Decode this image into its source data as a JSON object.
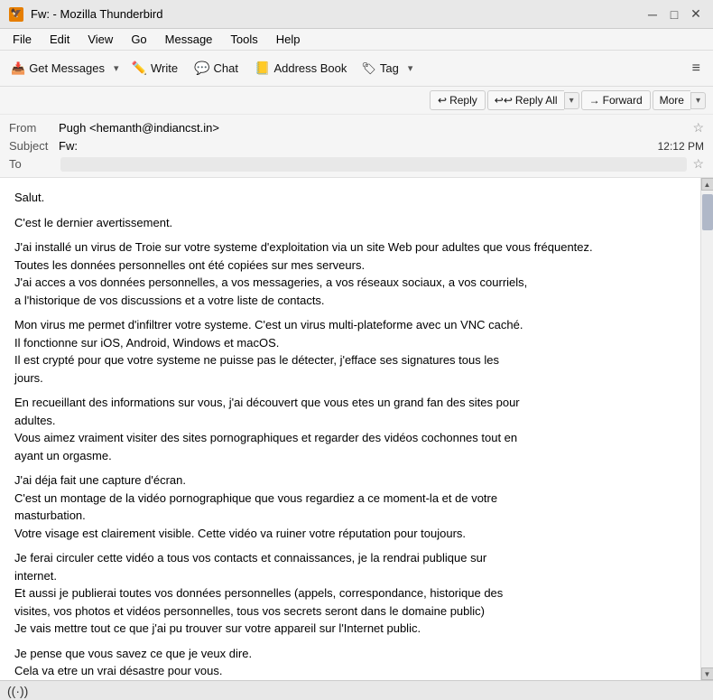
{
  "titlebar": {
    "title": "Fw: - Mozilla Thunderbird",
    "icon_label": "Fw",
    "minimize": "─",
    "maximize": "□",
    "close": "✕"
  },
  "menubar": {
    "items": [
      "File",
      "Edit",
      "View",
      "Go",
      "Message",
      "Tools",
      "Help"
    ]
  },
  "toolbar": {
    "get_messages_label": "Get Messages",
    "write_label": "Write",
    "chat_label": "Chat",
    "address_book_label": "Address Book",
    "tag_label": "Tag",
    "hamburger": "≡"
  },
  "email_actions": {
    "reply_label": "Reply",
    "reply_all_label": "Reply All",
    "forward_label": "Forward",
    "more_label": "More"
  },
  "email_header": {
    "from_label": "From",
    "from_value": "Pugh <hemanth@indiancst.in>",
    "subject_label": "Subject",
    "subject_value": "Fw:",
    "time": "12:12 PM",
    "to_label": "To"
  },
  "email_body": {
    "paragraphs": [
      "Salut.",
      "C'est le dernier avertissement.",
      "J'ai installé un virus de Troie sur votre systeme d'exploitation via un site Web pour adultes que vous fréquentez.\nToutes les données personnelles ont été copiées sur mes serveurs.\nJ'ai acces a vos données personnelles, a vos messageries, a vos réseaux sociaux, a vos courriels,\na l'historique de vos discussions et a votre liste de contacts.",
      "Mon virus me permet d'infiltrer votre systeme. C'est un virus multi-plateforme avec un VNC caché.\nIl fonctionne sur iOS, Android, Windows et macOS.\nIl est crypté pour que votre systeme ne puisse pas le détecter, j'efface ses signatures tous les\njours.",
      "En recueillant des informations sur vous, j'ai découvert que vous etes un grand fan des sites pour\nadultes.\nVous aimez vraiment visiter des sites pornographiques et regarder des vidéos cochonnes tout en\nayant un orgasme.",
      "J'ai déja fait une capture d'écran.\nC'est un montage de la vidéo pornographique que vous regardiez a ce moment-la et de votre\nmasturbation.\nVotre visage est clairement visible. Cette vidéo va ruiner votre réputation pour toujours.",
      "Je ferai circuler cette vidéo a tous vos contacts et connaissances, je la rendrai publique sur\ninternet.\nEt aussi je publierai toutes vos données personnelles (appels, correspondance, historique des\nvisites, vos photos et vidéos personnelles, tous vos secrets seront dans le domaine public)\nJe vais mettre tout ce que j'ai pu trouver sur votre appareil sur l'Internet public.",
      "Je pense que vous savez ce que je veux dire.\nCela va etre un vrai désastre pour vous."
    ]
  },
  "statusbar": {
    "icon": "((·))"
  }
}
